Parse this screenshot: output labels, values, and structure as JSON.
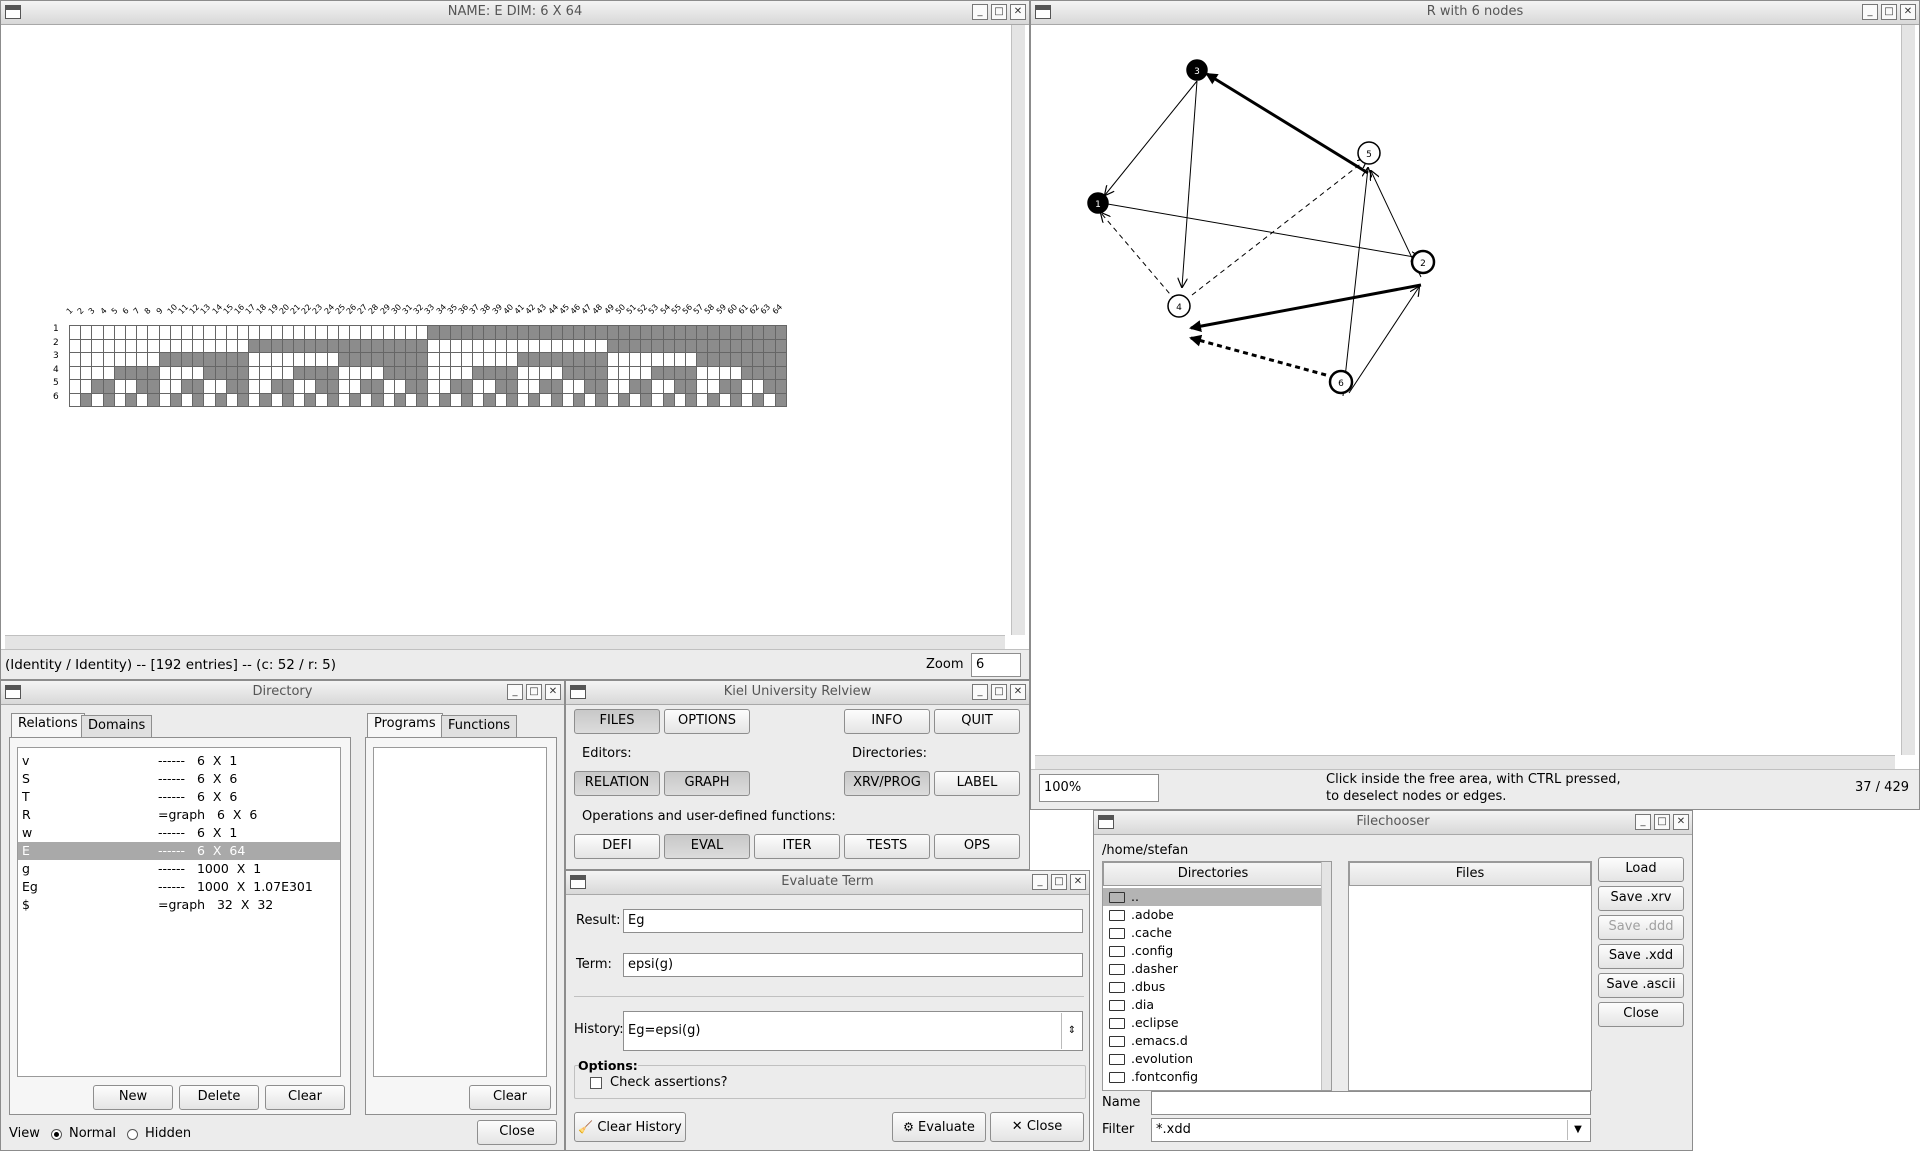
{
  "matrix_window": {
    "title": "NAME: E  DIM: 6 X 64",
    "status": "(Identity / Identity) -- [192 entries] -- (c: 52 / r: 5)",
    "zoom_label": "Zoom",
    "zoom_value": "6",
    "rows": 6,
    "cols": 64,
    "col_labels": [
      "1",
      "2",
      "3",
      "4",
      "5",
      "6",
      "7",
      "8",
      "9",
      "10",
      "11",
      "12",
      "13",
      "14",
      "15",
      "16",
      "17",
      "18",
      "19",
      "20",
      "21",
      "22",
      "23",
      "24",
      "25",
      "26",
      "27",
      "28",
      "29",
      "30",
      "31",
      "32",
      "33",
      "34",
      "35",
      "36",
      "37",
      "38",
      "39",
      "40",
      "41",
      "42",
      "43",
      "44",
      "45",
      "46",
      "47",
      "48",
      "49",
      "50",
      "51",
      "52",
      "53",
      "54",
      "55",
      "56",
      "57",
      "58",
      "59",
      "60",
      "61",
      "62",
      "63",
      "64"
    ],
    "row_labels": [
      "1",
      "2",
      "3",
      "4",
      "5",
      "6"
    ]
  },
  "graph_window": {
    "title": "R with 6 nodes",
    "zoom": "100%",
    "hint_line1": "Click inside the free area, with CTRL pressed,",
    "hint_line2": "to deselect nodes or edges.",
    "counter": "37 / 429",
    "nodes": [
      {
        "id": "3",
        "filled": true
      },
      {
        "id": "1",
        "filled": true
      },
      {
        "id": "5",
        "filled": false
      },
      {
        "id": "2",
        "filled": false
      },
      {
        "id": "4",
        "filled": false
      },
      {
        "id": "6",
        "filled": false
      }
    ]
  },
  "directory_window": {
    "title": "Directory",
    "tabs_left": [
      "Relations",
      "Domains"
    ],
    "tabs_right": [
      "Programs",
      "Functions"
    ],
    "relations": [
      {
        "name": "v",
        "info": "------   6  X  1"
      },
      {
        "name": "S",
        "info": "------   6  X  6"
      },
      {
        "name": "T",
        "info": "------   6  X  6"
      },
      {
        "name": "R",
        "info": "=graph   6  X  6"
      },
      {
        "name": "w",
        "info": "------   6  X  1"
      },
      {
        "name": "E",
        "info": "------   6  X  64"
      },
      {
        "name": "g",
        "info": "------   1000  X  1"
      },
      {
        "name": "Eg",
        "info": "------   1000  X  1.07E301"
      },
      {
        "name": "$",
        "info": "=graph   32  X  32"
      }
    ],
    "selected_index": 5,
    "buttons": {
      "new": "New",
      "delete": "Delete",
      "clear": "Clear",
      "clear_right": "Clear",
      "close": "Close"
    },
    "view_label": "View",
    "view_normal": "Normal",
    "view_hidden": "Hidden"
  },
  "relview_window": {
    "title": "Kiel University Relview",
    "files": "FILES",
    "options": "OPTIONS",
    "info": "INFO",
    "quit": "QUIT",
    "editors_label": "Editors:",
    "directories_label": "Directories:",
    "relation": "RELATION",
    "graph": "GRAPH",
    "xrvprog": "XRV/PROG",
    "label": "LABEL",
    "ops_label": "Operations and user-defined functions:",
    "defi": "DEFI",
    "eval": "EVAL",
    "iter": "ITER",
    "tests": "TESTS",
    "ops": "OPS"
  },
  "evaluate_window": {
    "title": "Evaluate Term",
    "result_label": "Result:",
    "result_value": "Eg",
    "term_label": "Term:",
    "term_value": "epsi(g)",
    "history_label": "History:",
    "history_value": "Eg=epsi(g)",
    "options_label": "Options:",
    "check_label": "Check assertions?",
    "clear_history": "Clear History",
    "evaluate": "Evaluate",
    "close": "Close"
  },
  "filechooser_window": {
    "title": "Filechooser",
    "path": "/home/stefan",
    "directories_header": "Directories",
    "files_header": "Files",
    "directories": [
      "..",
      ".adobe",
      ".cache",
      ".config",
      ".dasher",
      ".dbus",
      ".dia",
      ".eclipse",
      ".emacs.d",
      ".evolution",
      ".fontconfig"
    ],
    "buttons": {
      "load": "Load",
      "save_xrv": "Save .xrv",
      "save_ddd": "Save .ddd",
      "save_xdd": "Save .xdd",
      "save_ascii": "Save .ascii",
      "close": "Close"
    },
    "name_label": "Name",
    "name_value": "",
    "filter_label": "Filter",
    "filter_value": "*.xdd"
  }
}
